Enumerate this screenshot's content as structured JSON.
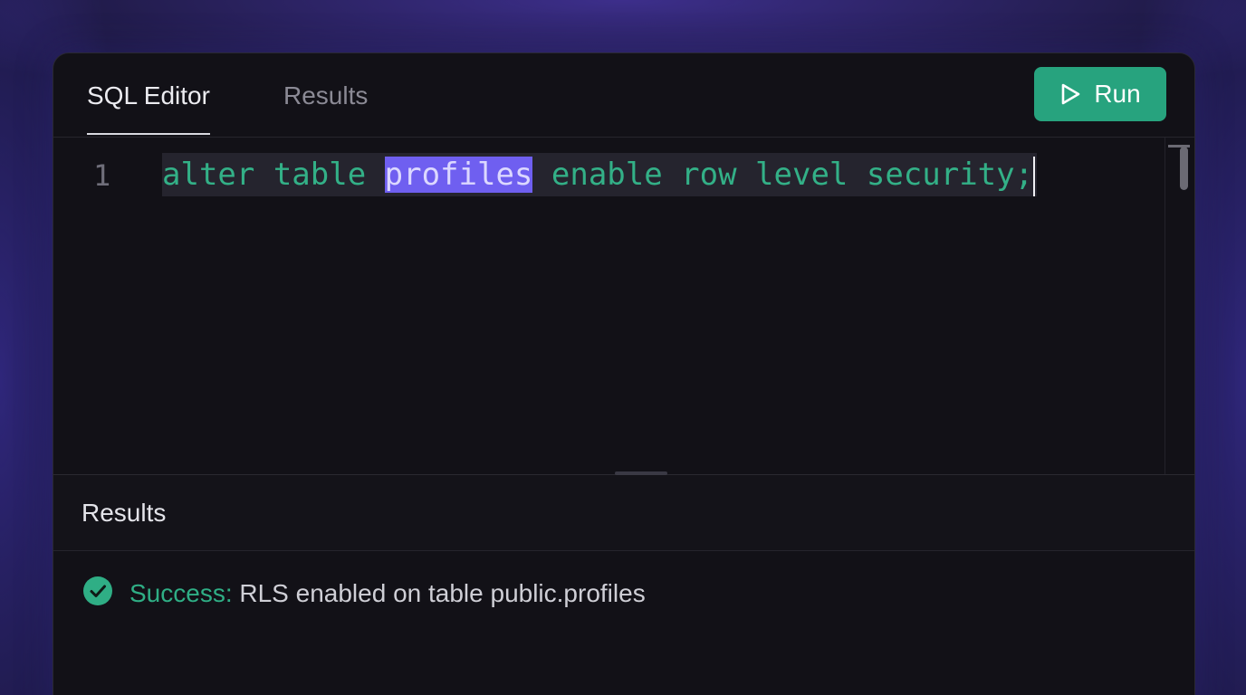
{
  "tabs": [
    {
      "label": "SQL Editor",
      "active": true
    },
    {
      "label": "Results",
      "active": false
    }
  ],
  "toolbar": {
    "run_label": "Run",
    "run_icon": "play-icon",
    "run_color": "#27a37e"
  },
  "editor": {
    "line_number": "1",
    "code_before": "alter table ",
    "code_selected": "profiles",
    "code_after": " enable row level security;",
    "keyword_color": "#33b087",
    "selection_color": "#6f5ff0"
  },
  "results": {
    "title": "Results",
    "status_icon": "check-circle-icon",
    "status_label": "Success:",
    "status_message": "RLS enabled on table public.profiles",
    "status_color": "#2fae85"
  }
}
